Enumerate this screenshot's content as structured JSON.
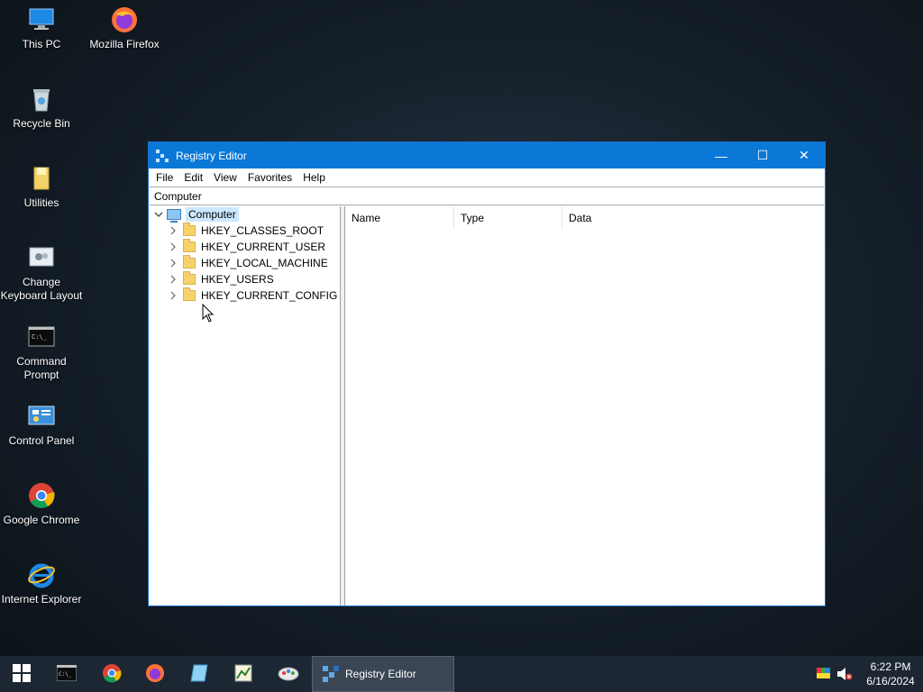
{
  "desktop": {
    "icons": [
      {
        "label": "This PC",
        "icon": "this-pc-icon"
      },
      {
        "label": "Mozilla Firefox",
        "icon": "firefox-icon"
      },
      {
        "label": "Recycle Bin",
        "icon": "recycle-bin-icon"
      },
      {
        "label": "Utilities",
        "icon": "folder-icon"
      },
      {
        "label": "Change Keyboard Layout",
        "icon": "keyboard-settings-icon"
      },
      {
        "label": "Command Prompt",
        "icon": "cmd-icon"
      },
      {
        "label": "Control Panel",
        "icon": "control-panel-icon"
      },
      {
        "label": "Google Chrome",
        "icon": "chrome-icon"
      },
      {
        "label": "Internet Explorer",
        "icon": "ie-icon"
      }
    ]
  },
  "window": {
    "title": "Registry Editor",
    "controls": {
      "minimize": "—",
      "maximize": "☐",
      "close": "✕"
    },
    "menu": [
      "File",
      "Edit",
      "View",
      "Favorites",
      "Help"
    ],
    "address": "Computer",
    "tree": {
      "root": "Computer",
      "children": [
        "HKEY_CLASSES_ROOT",
        "HKEY_CURRENT_USER",
        "HKEY_LOCAL_MACHINE",
        "HKEY_USERS",
        "HKEY_CURRENT_CONFIG"
      ]
    },
    "columns": [
      "Name",
      "Type",
      "Data"
    ]
  },
  "taskbar": {
    "active_app": "Registry Editor",
    "pinned": [
      "cmd-icon",
      "chrome-icon",
      "firefox-icon",
      "notepad-icon",
      "spreadsheet-icon",
      "paint-icon"
    ],
    "time": "6:22 PM",
    "date": "6/16/2024"
  },
  "colors": {
    "titlebar": "#0a78d7",
    "taskbar": "#1c2733",
    "selection": "#cce8ff"
  }
}
